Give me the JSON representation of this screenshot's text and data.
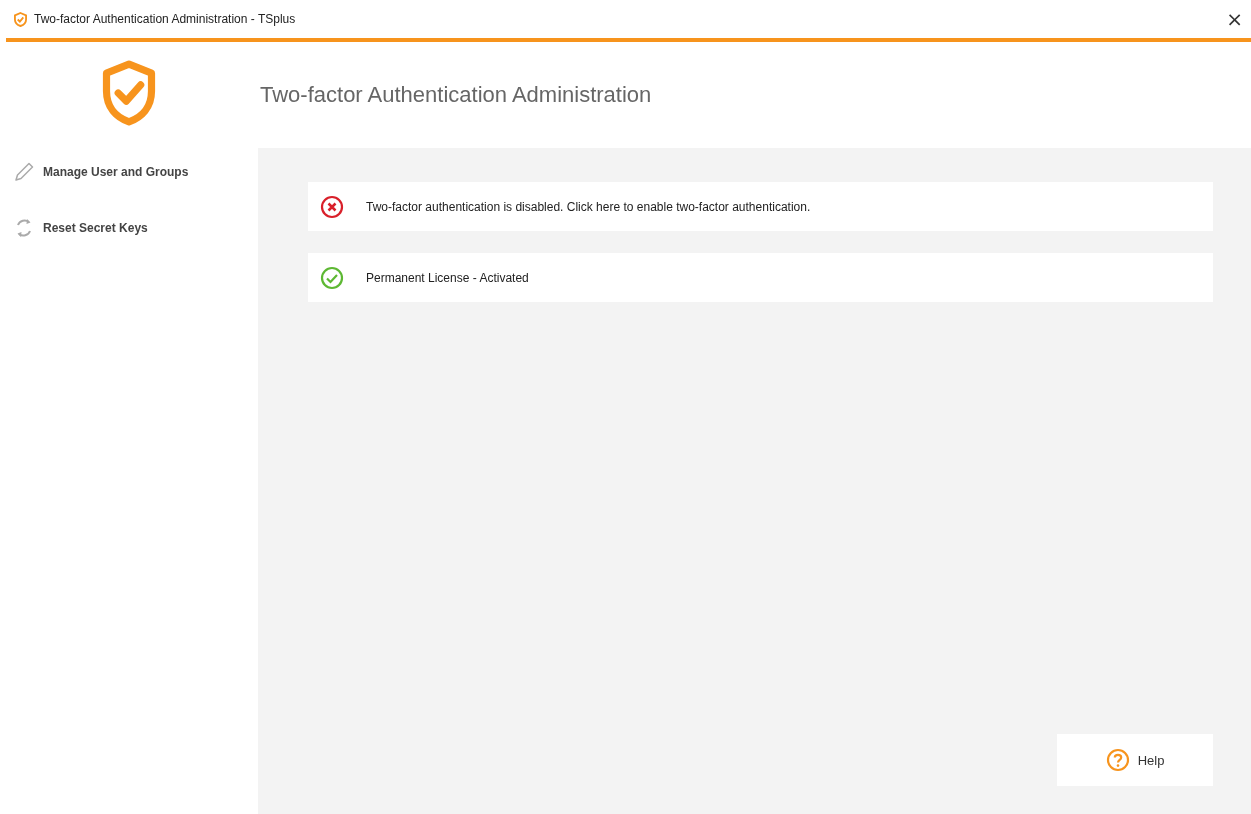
{
  "window": {
    "title": "Two-factor Authentication Administration - TSplus",
    "close": "×"
  },
  "heading": "Two-factor Authentication Administration",
  "sidebar": {
    "items": [
      {
        "label": "Manage User and Groups",
        "kind": "edit"
      },
      {
        "label": "Reset Secret Keys",
        "kind": "reset"
      }
    ]
  },
  "status": [
    {
      "text": "Two-factor authentication is disabled. Click here to enable two-factor authentication.",
      "kind": "error"
    },
    {
      "text": "Permanent License - Activated",
      "kind": "ok"
    }
  ],
  "help_button": {
    "label": "Help"
  }
}
